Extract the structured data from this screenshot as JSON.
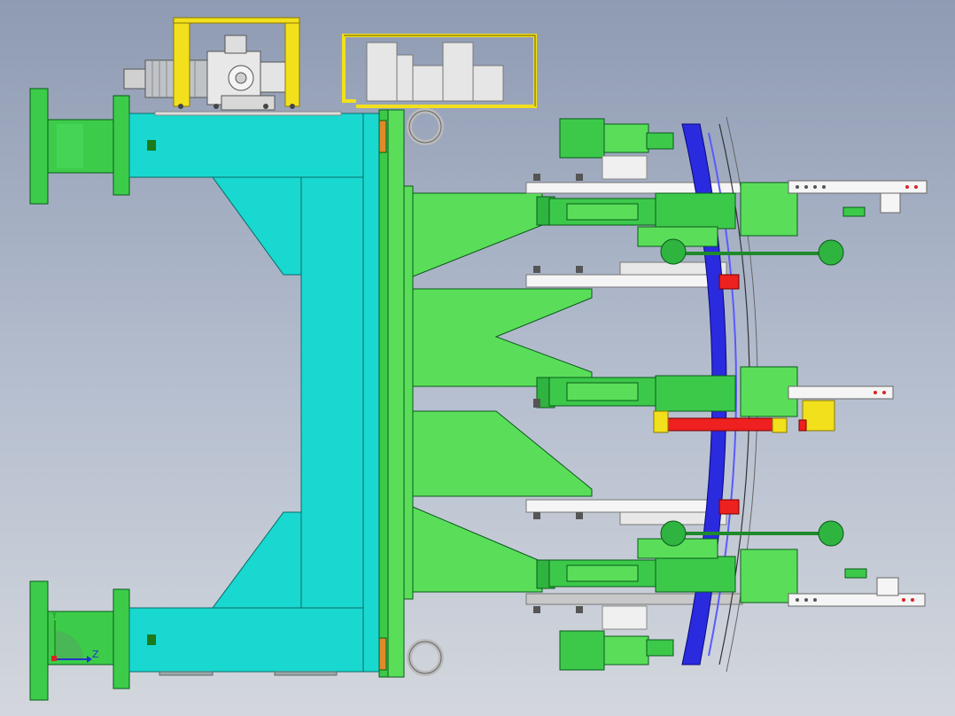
{
  "viewport": {
    "background_top": "#8f9bb3",
    "background_bottom": "#d3d7dd"
  },
  "colors": {
    "frame": "#19d8d0",
    "green_light": "#5ade5a",
    "green_dark": "#1f9a3a",
    "clamp_green": "#3cc94a",
    "guard_yellow": "#f2e01c",
    "part_blue": "#2a2adf",
    "red_pad": "#ee2020",
    "white_bar": "#f5f5f5",
    "grey_bar": "#c8c8c8",
    "motor_grey": "#d9d9d9"
  },
  "triad": {
    "axis_z_label": "Z",
    "axis_y_label": "Y"
  },
  "icons": {
    "triad": "axis-triad-icon"
  }
}
